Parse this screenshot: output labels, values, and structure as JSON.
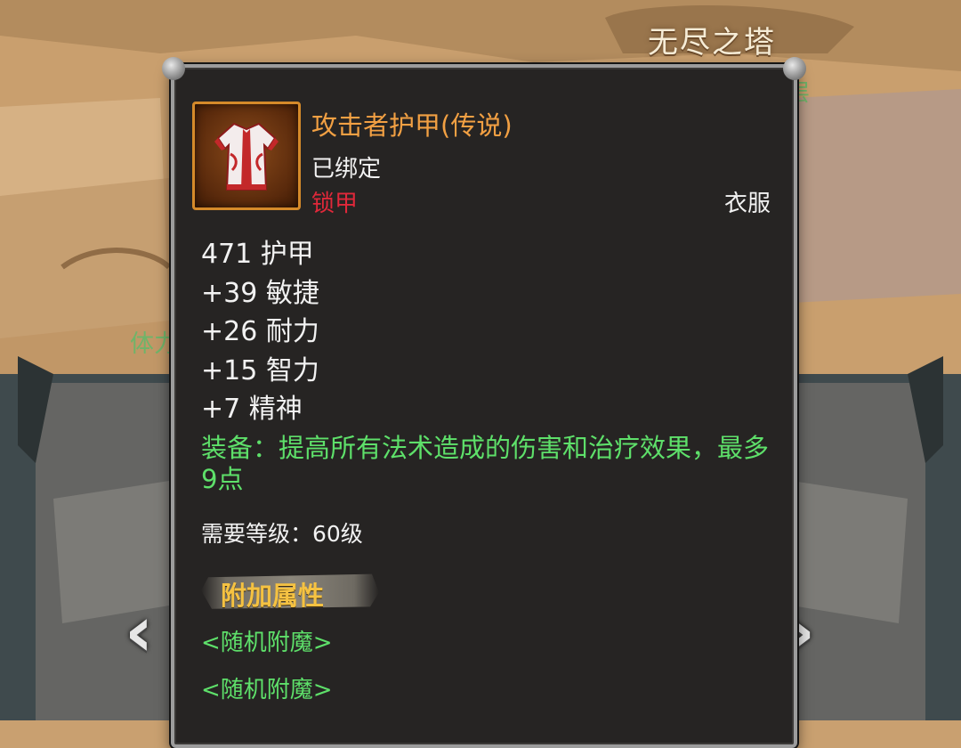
{
  "background": {
    "location_title": "无尽之塔",
    "floor_label_fragment": "层",
    "stamina_label_fragment": "体力",
    "nav": {
      "prev_symbol": "‹",
      "next_symbol": "›"
    }
  },
  "tooltip": {
    "item_name": "攻击者护甲(传说)",
    "binding": "已绑定",
    "armor_type": "锁甲",
    "slot": "衣服",
    "stats": [
      "471 护甲",
      "+39 敏捷",
      "+26 耐力",
      "+15 智力",
      "+7 精神"
    ],
    "equip_effect": "装备：提高所有法术造成的伤害和治疗效果，最多9点",
    "required_level": "需要等级：60级",
    "extra_section_title": "附加属性",
    "random_enchants": [
      "<随机附魔>",
      "<随机附魔>"
    ],
    "icon": "robe-armor-icon"
  },
  "colors": {
    "legendary_orange": "#f2a043",
    "armor_type_red": "#e0283a",
    "effect_green": "#5ee06a",
    "panel_bg": "#262423",
    "section_gold": "#f5c242"
  }
}
